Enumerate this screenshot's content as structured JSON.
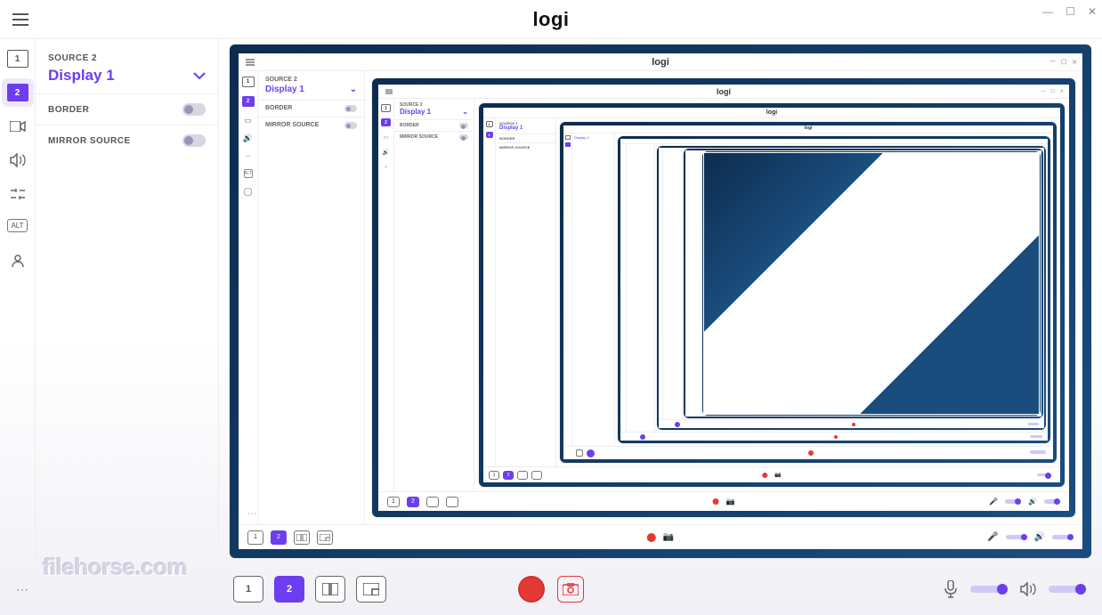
{
  "titlebar": {
    "logo": "logi",
    "minimize": "—",
    "maximize": "☐",
    "close": "✕"
  },
  "rail": {
    "source1": "1",
    "source2": "2",
    "alt": "ALT"
  },
  "panel": {
    "source_label": "SOURCE 2",
    "source_value": "Display 1",
    "border_label": "BORDER",
    "mirror_label": "MIRROR SOURCE"
  },
  "bottom": {
    "scene1": "1",
    "scene2": "2",
    "scene3": "1|2",
    "scene4": "1|2"
  },
  "watermark": "filehorse.com",
  "colors": {
    "accent": "#6c3ef0",
    "record": "#e53935",
    "bezel": "#0d2c4f"
  }
}
